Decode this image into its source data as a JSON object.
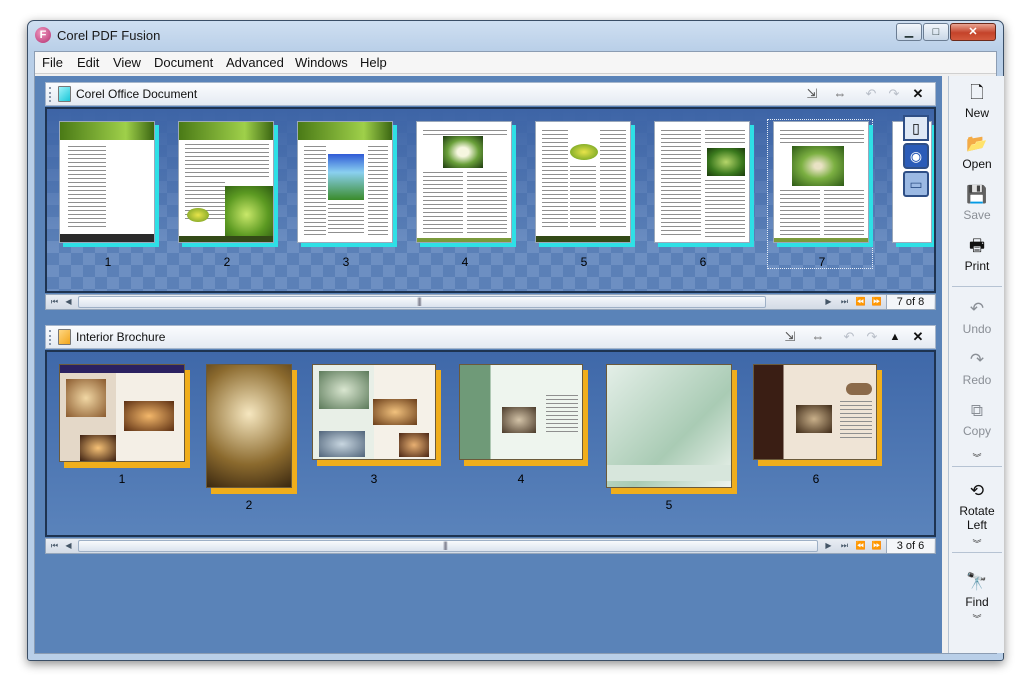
{
  "window": {
    "title": "Corel PDF Fusion",
    "app_icon_glyph": "F"
  },
  "menu": [
    "File",
    "Edit",
    "View",
    "Document",
    "Advanced",
    "Windows",
    "Help"
  ],
  "panels": {
    "top": {
      "title": "Corel Office Document",
      "pages": [
        "1",
        "2",
        "3",
        "4",
        "5",
        "6",
        "7"
      ],
      "page_counter": "7 of 8",
      "selected_page": 7
    },
    "bottom": {
      "title": "Interior Brochure",
      "pages": [
        "1",
        "2",
        "3",
        "4",
        "5",
        "6"
      ],
      "page_counter": "3 of 6"
    }
  },
  "toolbar": {
    "new": "New",
    "open": "Open",
    "save": "Save",
    "print": "Print",
    "undo": "Undo",
    "redo": "Redo",
    "copy": "Copy",
    "rotate_line1": "Rotate",
    "rotate_line2": "Left",
    "find": "Find"
  },
  "colors": {
    "accent_cyan": "#2ee0e6",
    "accent_orange": "#f0ae1c",
    "workspace_blue": "#5a83b8"
  }
}
